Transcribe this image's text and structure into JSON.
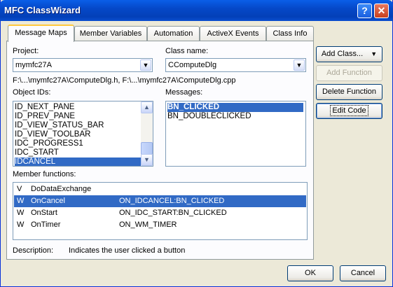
{
  "window": {
    "title": "MFC ClassWizard"
  },
  "tabs": [
    {
      "label": "Message Maps",
      "active": true
    },
    {
      "label": "Member Variables",
      "active": false
    },
    {
      "label": "Automation",
      "active": false
    },
    {
      "label": "ActiveX Events",
      "active": false
    },
    {
      "label": "Class Info",
      "active": false
    }
  ],
  "project": {
    "label": "Project:",
    "value": "mymfc27A"
  },
  "class_name": {
    "label": "Class name:",
    "value": "CComputeDlg"
  },
  "file_path": "F:\\...\\mymfc27A\\ComputeDlg.h, F:\\...\\mymfc27A\\ComputeDlg.cpp",
  "object_ids": {
    "label": "Object IDs:",
    "items": [
      "ID_NEXT_PANE",
      "ID_PREV_PANE",
      "ID_VIEW_STATUS_BAR",
      "ID_VIEW_TOOLBAR",
      "IDC_PROGRESS1",
      "IDC_START",
      "IDCANCEL"
    ],
    "selected": "IDCANCEL"
  },
  "messages": {
    "label": "Messages:",
    "items": [
      "BN_CLICKED",
      "BN_DOUBLECLICKED"
    ],
    "selected": "BN_CLICKED"
  },
  "member_functions": {
    "label": "Member functions:",
    "rows": [
      {
        "type": "V",
        "name": "DoDataExchange",
        "handler": ""
      },
      {
        "type": "W",
        "name": "OnCancel",
        "handler": "ON_IDCANCEL:BN_CLICKED"
      },
      {
        "type": "W",
        "name": "OnStart",
        "handler": "ON_IDC_START:BN_CLICKED"
      },
      {
        "type": "W",
        "name": "OnTimer",
        "handler": "ON_WM_TIMER"
      }
    ],
    "selected_index": 1
  },
  "description": {
    "label": "Description:",
    "text": "Indicates the user clicked a button"
  },
  "buttons": {
    "add_class": "Add Class...",
    "add_function": "Add Function",
    "delete_function": "Delete Function",
    "edit_code": "Edit Code",
    "ok": "OK",
    "cancel": "Cancel"
  },
  "colors": {
    "titlebar": "#0548C8",
    "selection": "#316AC5",
    "dialog_bg": "#ECE9D8",
    "tab_highlight": "#FFC83C"
  }
}
